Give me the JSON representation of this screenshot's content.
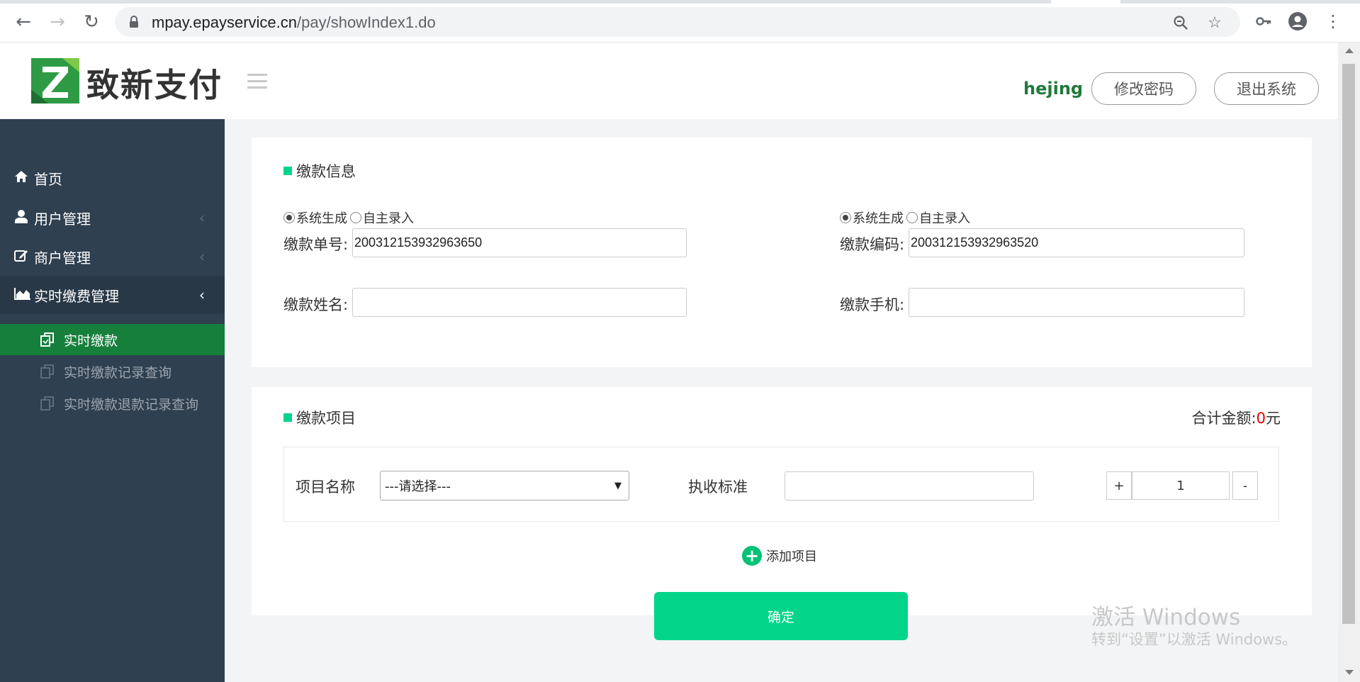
{
  "browser": {
    "url_host": "mpay.epayservice.cn",
    "url_path": "/pay/showIndex1.do"
  },
  "header": {
    "brand": "致新支付",
    "username": "hejing",
    "change_password": "修改密码",
    "logout": "退出系统"
  },
  "sidebar": {
    "items": [
      {
        "label": "首页",
        "icon": "home-icon"
      },
      {
        "label": "用户管理",
        "icon": "user-icon"
      },
      {
        "label": "商户管理",
        "icon": "edit-icon"
      },
      {
        "label": "实时缴费管理",
        "icon": "area-chart-icon"
      }
    ],
    "sub_items": [
      {
        "label": "实时缴款"
      },
      {
        "label": "实时缴款记录查询"
      },
      {
        "label": "实时缴款退款记录查询"
      }
    ]
  },
  "payment_info": {
    "title": "缴款信息",
    "order_radio": {
      "system": "系统生成",
      "manual": "自主录入",
      "selected": "system"
    },
    "code_radio": {
      "system": "系统生成",
      "manual": "自主录入",
      "selected": "system"
    },
    "order_no_label": "缴款单号:",
    "order_no_value": "200312153932963650",
    "code_label": "缴款编码:",
    "code_value": "200312153932963520",
    "name_label": "缴款姓名:",
    "name_value": "",
    "phone_label": "缴款手机:",
    "phone_value": ""
  },
  "payment_items": {
    "title": "缴款项目",
    "total_label": "合计金额:",
    "total_amount": "0",
    "total_unit": "元",
    "item_name_label": "项目名称",
    "item_select": "---请选择---",
    "standard_label": "执收标准",
    "standard_value": "",
    "plus": "+",
    "quantity": "1",
    "minus": "-",
    "add_item": "添加项目",
    "confirm": "确定"
  },
  "watermark": {
    "line1": "激活 Windows",
    "line2": "转到“设置”以激活 Windows。"
  },
  "colors": {
    "sidebar_bg": "#2f4050",
    "selected_green": "#167f3c",
    "accent": "#02d58a",
    "username": "#1f7a3a"
  }
}
